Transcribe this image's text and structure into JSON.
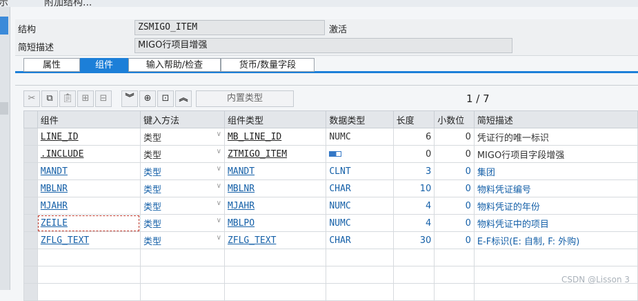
{
  "topbar": {
    "left_fragment": "示",
    "item": "附加结构..."
  },
  "header": {
    "struct_label": "结构",
    "struct_value": "ZSMIGO_ITEM",
    "status": "激活",
    "desc_label": "简短描述",
    "desc_value": "MIGO行项目增强"
  },
  "tabs": [
    {
      "label": "属性",
      "active": false
    },
    {
      "label": "组件",
      "active": true
    },
    {
      "label": "输入帮助/检查",
      "active": false
    },
    {
      "label": "货币/数量字段",
      "active": false
    }
  ],
  "toolbar": {
    "builtin_type_label": "内置类型",
    "pager": "1 / 7"
  },
  "table": {
    "columns": [
      "组件",
      "键入方法",
      "组件类型",
      "数据类型",
      "长度",
      "小数位",
      "简短描述"
    ],
    "rows": [
      {
        "component": "LINE_ID",
        "method": "类型",
        "comp_type": "MB_LINE_ID",
        "dtype": "NUMC",
        "length": "6",
        "decimals": "0",
        "desc": "凭证行的唯一标识",
        "style": "dark"
      },
      {
        "component": ".INCLUDE",
        "method": "类型",
        "comp_type": "ZTMIGO_ITEM",
        "dtype": "",
        "length": "0",
        "decimals": "0",
        "desc": "MIGO行项目字段增强",
        "style": "dark"
      },
      {
        "component": "MANDT",
        "method": "类型",
        "comp_type": "MANDT",
        "dtype": "CLNT",
        "length": "3",
        "decimals": "0",
        "desc": "集团",
        "style": "blue"
      },
      {
        "component": "MBLNR",
        "method": "类型",
        "comp_type": "MBLNR",
        "dtype": "CHAR",
        "length": "10",
        "decimals": "0",
        "desc": "物料凭证编号",
        "style": "blue"
      },
      {
        "component": "MJAHR",
        "method": "类型",
        "comp_type": "MJAHR",
        "dtype": "NUMC",
        "length": "4",
        "decimals": "0",
        "desc": "物料凭证的年份",
        "style": "blue"
      },
      {
        "component": "ZEILE",
        "method": "类型",
        "comp_type": "MBLPO",
        "dtype": "NUMC",
        "length": "4",
        "decimals": "0",
        "desc": "物料凭证中的项目",
        "style": "blue"
      },
      {
        "component": "ZFLG_TEXT",
        "method": "类型",
        "comp_type": "ZFLG_TEXT",
        "dtype": "CHAR",
        "length": "30",
        "decimals": "0",
        "desc": "E-F标识(E: 自制, F: 外购)",
        "style": "blue"
      }
    ]
  },
  "watermark": "CSDN @Lisson 3"
}
